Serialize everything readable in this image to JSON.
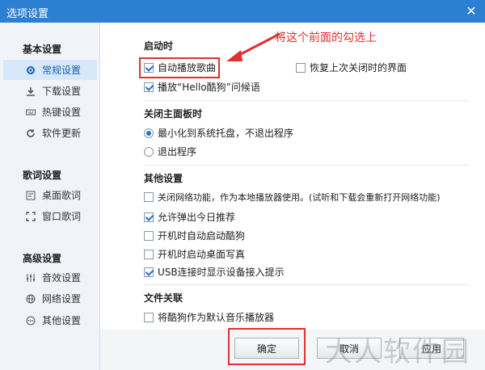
{
  "window": {
    "title": "选项设置",
    "close": "✕"
  },
  "sidebar": {
    "groups": [
      {
        "title": "基本设置",
        "items": [
          "常规设置",
          "下载设置",
          "热键设置",
          "软件更新"
        ]
      },
      {
        "title": "歌词设置",
        "items": [
          "桌面歌词",
          "窗口歌词"
        ]
      },
      {
        "title": "高级设置",
        "items": [
          "音效设置",
          "网络设置",
          "其他设置"
        ]
      }
    ],
    "active_item": "常规设置"
  },
  "sections": {
    "startup": {
      "title": "启动时",
      "auto_play": {
        "label": "自动播放歌曲",
        "checked": true
      },
      "restore_last": {
        "label": "恢复上次关闭时的界面",
        "checked": false
      },
      "play_hello": {
        "label": "播放“Hello酷狗”问候语",
        "checked": true
      }
    },
    "close_panel": {
      "title": "关闭主面板时",
      "minimize": {
        "label": "最小化到系统托盘，不退出程序",
        "selected": true
      },
      "exit": {
        "label": "退出程序",
        "selected": false
      }
    },
    "other": {
      "title": "其他设置",
      "items": [
        {
          "label": "关闭网络功能，作为本地播放器使用。(试听和下载会重新打开网络功能)",
          "checked": false
        },
        {
          "label": "允许弹出今日推荐",
          "checked": true
        },
        {
          "label": "开机时自动启动酷狗",
          "checked": false
        },
        {
          "label": "开机时启动桌面写真",
          "checked": false
        },
        {
          "label": "USB连接时显示设备接入提示",
          "checked": true
        }
      ]
    },
    "file_assoc": {
      "title": "文件关联",
      "default_player": {
        "label": "将酷狗作为默认音乐播放器",
        "checked": false
      }
    }
  },
  "annotation": {
    "text": "将这个前面的勾选上"
  },
  "buttons": {
    "ok": "确定",
    "cancel": "取消",
    "apply": "应用"
  },
  "watermark": "大人软件园",
  "colors": {
    "titlebar": "#2d7fd3",
    "highlight": "#e03030",
    "accent": "#1d6fd0"
  }
}
